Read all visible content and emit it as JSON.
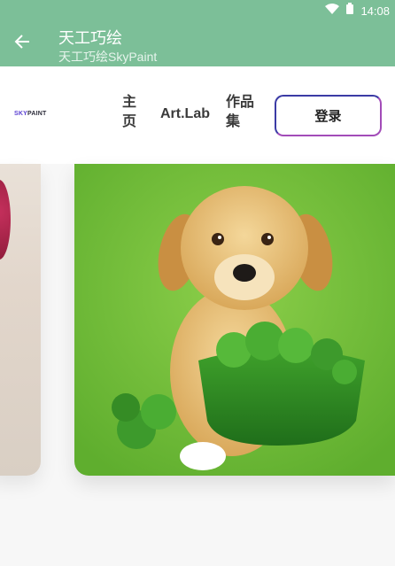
{
  "status_bar": {
    "time": "14:08",
    "icons": [
      "wifi-icon",
      "battery-icon"
    ]
  },
  "app_bar": {
    "title": "天工巧绘",
    "subtitle": "天工巧绘SkyPaint",
    "back_icon": "arrow-left-icon"
  },
  "nav": {
    "logo_sky": "SKY",
    "logo_paint": "PAINT",
    "home_line1": "主",
    "home_line2": "页",
    "artlab": "Art.Lab",
    "works_line1": "作品",
    "works_line2": "集",
    "login": "登录"
  },
  "colors": {
    "app_bar": "#7cbf98",
    "accent_gradient_start": "#3b3ba5",
    "accent_gradient_end": "#a24bb8"
  }
}
